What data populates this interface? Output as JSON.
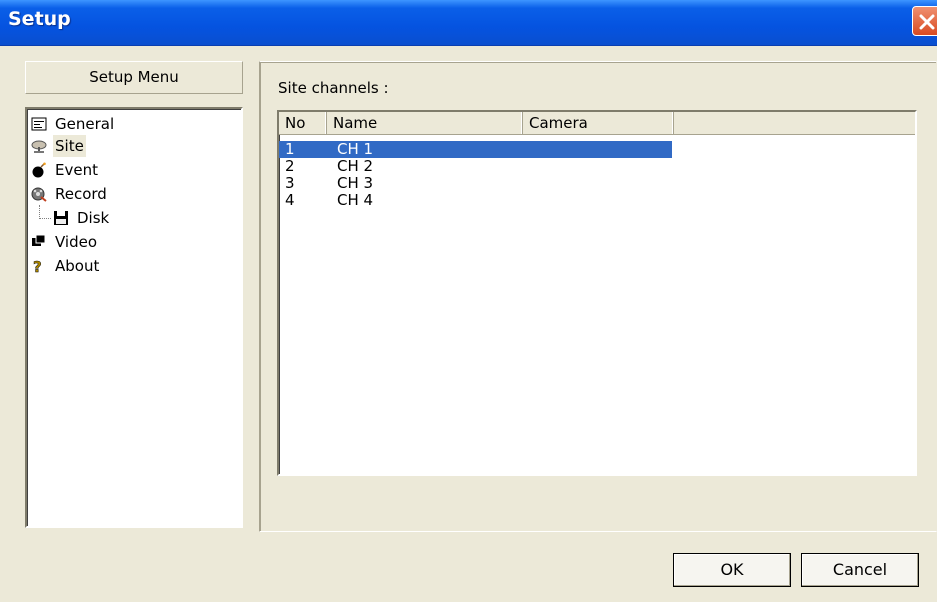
{
  "window": {
    "title": "Setup"
  },
  "menu": {
    "header": "Setup Menu",
    "items": [
      {
        "label": "General",
        "icon": "general-settings-icon"
      },
      {
        "label": "Site",
        "icon": "site-icon",
        "selected": true
      },
      {
        "label": "Event",
        "icon": "event-bomb-icon"
      },
      {
        "label": "Record",
        "icon": "record-film-icon"
      },
      {
        "label": "Disk",
        "icon": "floppy-disk-icon"
      },
      {
        "label": "Video",
        "icon": "video-icon"
      },
      {
        "label": "About",
        "icon": "about-help-icon"
      }
    ]
  },
  "site": {
    "group_label": "Site channels :",
    "columns": [
      "No",
      "Name",
      "Camera"
    ],
    "rows": [
      {
        "no": "1",
        "name": "CH 1",
        "camera": "",
        "selected": true
      },
      {
        "no": "2",
        "name": "CH 2",
        "camera": ""
      },
      {
        "no": "3",
        "name": "CH 3",
        "camera": ""
      },
      {
        "no": "4",
        "name": "CH 4",
        "camera": ""
      }
    ]
  },
  "buttons": {
    "ok": "OK",
    "cancel": "Cancel"
  },
  "colors": {
    "titlebar": "#0553e0",
    "selection": "#316ac5",
    "face": "#ece9d8"
  }
}
